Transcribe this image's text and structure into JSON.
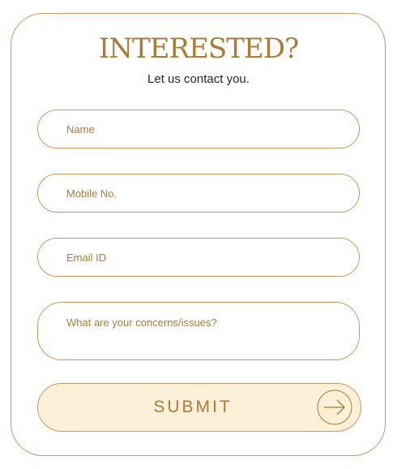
{
  "header": {
    "title": "INTERESTED?",
    "subtitle": "Let us contact you."
  },
  "form": {
    "name_placeholder": "Name",
    "mobile_placeholder": "Mobile No.",
    "email_placeholder": "Email ID",
    "concerns_placeholder": "What are your concerns/issues?",
    "submit_label": "SUBMIT",
    "submit_icon": "arrow-right-circle-icon"
  },
  "colors": {
    "accent": "#a87b37",
    "border": "#c39a62",
    "button_fill": "#fdf0d8",
    "subtitle_text": "#2f2418"
  }
}
